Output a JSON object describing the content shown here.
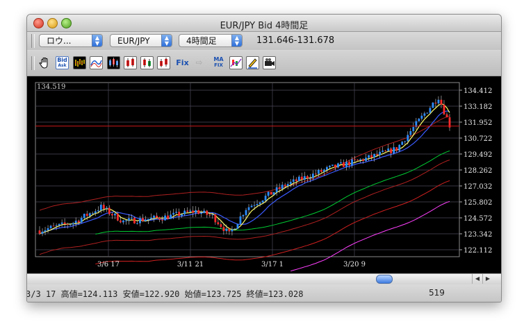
{
  "window": {
    "title": "EUR/JPY Bid 4時間足"
  },
  "toolbar": {
    "account_popup": "ロウ...",
    "pair_popup": "EUR/JPY",
    "period_popup": "4時間足",
    "rate": "131.646-131.678",
    "tools": [
      {
        "name": "hand-tool-icon"
      },
      {
        "name": "bid-ask-icon",
        "label_top": "Bid",
        "label_bottom": "Ask"
      },
      {
        "name": "bar-chart-icon"
      },
      {
        "name": "line-chart-icon"
      },
      {
        "name": "candlestick-icon"
      },
      {
        "name": "candle-red-icon"
      },
      {
        "name": "candle-mixed-icon"
      },
      {
        "name": "candle-red-green-icon"
      },
      {
        "name": "fix-icon",
        "label": "Fix"
      },
      {
        "name": "arrow-disabled-icon"
      },
      {
        "name": "ma-fix-icon",
        "label_top": "MA",
        "label_bottom": "FIX"
      },
      {
        "name": "indicator-icon"
      },
      {
        "name": "pencil-draw-icon"
      },
      {
        "name": "camera-icon"
      }
    ]
  },
  "chart_data": {
    "type": "candlestick",
    "current_price_line": 131.646,
    "top_left_label": "134.519",
    "y_ticks": [
      "134.412",
      "133.182",
      "131.952",
      "130.722",
      "129.492",
      "128.262",
      "127.032",
      "125.802",
      "124.572",
      "123.342",
      "122.112"
    ],
    "x_ticks": [
      "3/6 17",
      "3/11 21",
      "3/17 1",
      "3/20 9"
    ],
    "ylim": [
      122.112,
      134.412
    ],
    "colors": {
      "up": "#2a8cff",
      "down": "#ff2a2a",
      "background": "#000000",
      "grid": "#4a4a5a"
    },
    "overlays": [
      {
        "color": "#ffff66"
      },
      {
        "color": "#3b5bff"
      },
      {
        "color": "#00cc33"
      },
      {
        "color": "#ff3030"
      },
      {
        "color": "#ff40ff"
      }
    ]
  },
  "status": {
    "info": "3/3 17  高値=124.113 安値=122.920 始値=123.725 終値=123.028",
    "count": "519"
  }
}
